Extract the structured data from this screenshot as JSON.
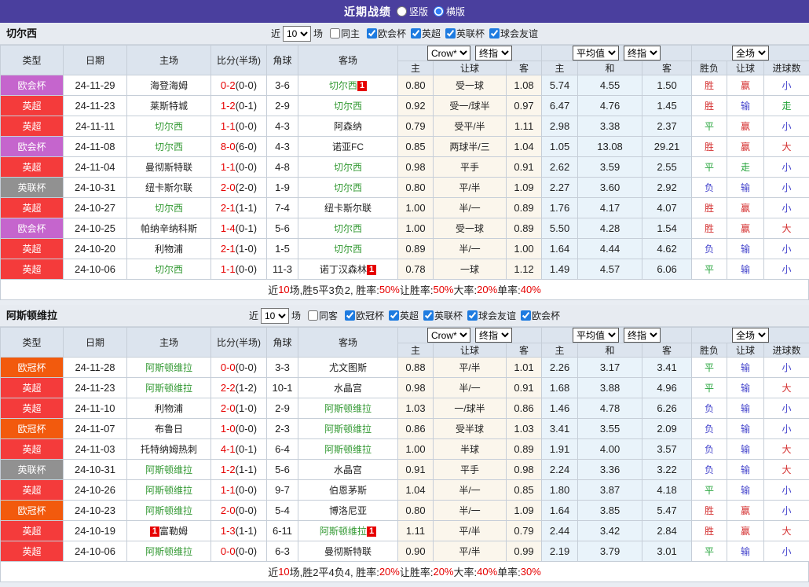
{
  "topbar": {
    "title": "近期战绩",
    "radios": [
      {
        "label": "竖版",
        "checked": false
      },
      {
        "label": "横版",
        "checked": true
      }
    ]
  },
  "columns": [
    "类型",
    "日期",
    "主场",
    "比分(半场)",
    "角球",
    "客场",
    "主",
    "让球",
    "客",
    "主",
    "和",
    "客",
    "胜负",
    "让球",
    "进球数"
  ],
  "dropdowns": {
    "book": "Crow*",
    "final_a": "终指",
    "avg": "平均值",
    "final_b": "终指",
    "scope": "全场"
  },
  "comp_colors": {
    "欧会杯": "#c565cd",
    "英超": "#f43b3b",
    "英联杯": "#919191",
    "欧冠杯": "#f25a0d"
  },
  "result_colors": {
    "r": "res-r",
    "g": "res-g",
    "b": "res-b"
  },
  "sections": [
    {
      "team": "切尔西",
      "filter": {
        "near": "近",
        "count": "10",
        "games": "场",
        "same": "同主",
        "comps": [
          "欧会杯",
          "英超",
          "英联杯",
          "球会友谊"
        ]
      },
      "rows": [
        {
          "comp": "欧会杯",
          "date": "24-11-29",
          "home": {
            "name": "海登海姆"
          },
          "score": "0-2",
          "half": "(0-0)",
          "corner": "3-6",
          "away": {
            "name": "切尔西",
            "focus": true,
            "rank": "1"
          },
          "odds": [
            "0.80",
            "受一球",
            "1.08"
          ],
          "avg": [
            "5.74",
            "4.55",
            "1.50"
          ],
          "res": [
            [
              "胜",
              "r"
            ],
            [
              "赢",
              "r"
            ],
            [
              "小",
              "b"
            ]
          ]
        },
        {
          "comp": "英超",
          "date": "24-11-23",
          "home": {
            "name": "莱斯特城"
          },
          "score": "1-2",
          "half": "(0-1)",
          "corner": "2-9",
          "away": {
            "name": "切尔西",
            "focus": true
          },
          "odds": [
            "0.92",
            "受一/球半",
            "0.97"
          ],
          "avg": [
            "6.47",
            "4.76",
            "1.45"
          ],
          "res": [
            [
              "胜",
              "r"
            ],
            [
              "输",
              "b"
            ],
            [
              "走",
              "g"
            ]
          ]
        },
        {
          "comp": "英超",
          "date": "24-11-11",
          "home": {
            "name": "切尔西",
            "focus": true
          },
          "score": "1-1",
          "half": "(0-0)",
          "corner": "4-3",
          "away": {
            "name": "阿森纳"
          },
          "odds": [
            "0.79",
            "受平/半",
            "1.11"
          ],
          "avg": [
            "2.98",
            "3.38",
            "2.37"
          ],
          "res": [
            [
              "平",
              "g"
            ],
            [
              "赢",
              "r"
            ],
            [
              "小",
              "b"
            ]
          ]
        },
        {
          "comp": "欧会杯",
          "date": "24-11-08",
          "home": {
            "name": "切尔西",
            "focus": true
          },
          "score": "8-0",
          "half": "(6-0)",
          "corner": "4-3",
          "away": {
            "name": "诺亚FC"
          },
          "odds": [
            "0.85",
            "两球半/三",
            "1.04"
          ],
          "avg": [
            "1.05",
            "13.08",
            "29.21"
          ],
          "res": [
            [
              "胜",
              "r"
            ],
            [
              "赢",
              "r"
            ],
            [
              "大",
              "r"
            ]
          ]
        },
        {
          "comp": "英超",
          "date": "24-11-04",
          "home": {
            "name": "曼彻斯特联"
          },
          "score": "1-1",
          "half": "(0-0)",
          "corner": "4-8",
          "away": {
            "name": "切尔西",
            "focus": true
          },
          "odds": [
            "0.98",
            "平手",
            "0.91"
          ],
          "avg": [
            "2.62",
            "3.59",
            "2.55"
          ],
          "res": [
            [
              "平",
              "g"
            ],
            [
              "走",
              "g"
            ],
            [
              "小",
              "b"
            ]
          ]
        },
        {
          "comp": "英联杯",
          "date": "24-10-31",
          "home": {
            "name": "纽卡斯尔联"
          },
          "score": "2-0",
          "half": "(2-0)",
          "corner": "1-9",
          "away": {
            "name": "切尔西",
            "focus": true
          },
          "odds": [
            "0.80",
            "平/半",
            "1.09"
          ],
          "avg": [
            "2.27",
            "3.60",
            "2.92"
          ],
          "res": [
            [
              "负",
              "b"
            ],
            [
              "输",
              "b"
            ],
            [
              "小",
              "b"
            ]
          ]
        },
        {
          "comp": "英超",
          "date": "24-10-27",
          "home": {
            "name": "切尔西",
            "focus": true
          },
          "score": "2-1",
          "half": "(1-1)",
          "corner": "7-4",
          "away": {
            "name": "纽卡斯尔联"
          },
          "odds": [
            "1.00",
            "半/一",
            "0.89"
          ],
          "avg": [
            "1.76",
            "4.17",
            "4.07"
          ],
          "res": [
            [
              "胜",
              "r"
            ],
            [
              "赢",
              "r"
            ],
            [
              "小",
              "b"
            ]
          ]
        },
        {
          "comp": "欧会杯",
          "date": "24-10-25",
          "home": {
            "name": "帕纳辛纳科斯"
          },
          "score": "1-4",
          "half": "(0-1)",
          "corner": "5-6",
          "away": {
            "name": "切尔西",
            "focus": true
          },
          "odds": [
            "1.00",
            "受一球",
            "0.89"
          ],
          "avg": [
            "5.50",
            "4.28",
            "1.54"
          ],
          "res": [
            [
              "胜",
              "r"
            ],
            [
              "赢",
              "r"
            ],
            [
              "大",
              "r"
            ]
          ]
        },
        {
          "comp": "英超",
          "date": "24-10-20",
          "home": {
            "name": "利物浦"
          },
          "score": "2-1",
          "half": "(1-0)",
          "corner": "1-5",
          "away": {
            "name": "切尔西",
            "focus": true
          },
          "odds": [
            "0.89",
            "半/一",
            "1.00"
          ],
          "avg": [
            "1.64",
            "4.44",
            "4.62"
          ],
          "res": [
            [
              "负",
              "b"
            ],
            [
              "输",
              "b"
            ],
            [
              "小",
              "b"
            ]
          ]
        },
        {
          "comp": "英超",
          "date": "24-10-06",
          "home": {
            "name": "切尔西",
            "focus": true
          },
          "score": "1-1",
          "half": "(0-0)",
          "corner": "11-3",
          "away": {
            "name": "诺丁汉森林",
            "rank": "1"
          },
          "odds": [
            "0.78",
            "一球",
            "1.12"
          ],
          "avg": [
            "1.49",
            "4.57",
            "6.06"
          ],
          "res": [
            [
              "平",
              "g"
            ],
            [
              "输",
              "b"
            ],
            [
              "小",
              "b"
            ]
          ]
        }
      ],
      "summary": [
        [
          "近",
          "k"
        ],
        [
          "10",
          "r"
        ],
        [
          "场,胜5平3负2, 胜率:",
          "k"
        ],
        [
          "50%",
          "r"
        ],
        [
          " 让胜率:",
          "k"
        ],
        [
          "50%",
          "r"
        ],
        [
          " 大率:",
          "k"
        ],
        [
          "20%",
          "r"
        ],
        [
          " 单率:",
          "k"
        ],
        [
          "40%",
          "r"
        ]
      ]
    },
    {
      "team": "阿斯顿维拉",
      "filter": {
        "near": "近",
        "count": "10",
        "games": "场",
        "same": "同客",
        "comps": [
          "欧冠杯",
          "英超",
          "英联杯",
          "球会友谊",
          "欧会杯"
        ]
      },
      "rows": [
        {
          "comp": "欧冠杯",
          "date": "24-11-28",
          "home": {
            "name": "阿斯顿维拉",
            "focus": true
          },
          "score": "0-0",
          "half": "(0-0)",
          "corner": "3-3",
          "away": {
            "name": "尤文图斯"
          },
          "odds": [
            "0.88",
            "平/半",
            "1.01"
          ],
          "avg": [
            "2.26",
            "3.17",
            "3.41"
          ],
          "res": [
            [
              "平",
              "g"
            ],
            [
              "输",
              "b"
            ],
            [
              "小",
              "b"
            ]
          ]
        },
        {
          "comp": "英超",
          "date": "24-11-23",
          "home": {
            "name": "阿斯顿维拉",
            "focus": true
          },
          "score": "2-2",
          "half": "(1-2)",
          "corner": "10-1",
          "away": {
            "name": "水晶宫"
          },
          "odds": [
            "0.98",
            "半/一",
            "0.91"
          ],
          "avg": [
            "1.68",
            "3.88",
            "4.96"
          ],
          "res": [
            [
              "平",
              "g"
            ],
            [
              "输",
              "b"
            ],
            [
              "大",
              "r"
            ]
          ]
        },
        {
          "comp": "英超",
          "date": "24-11-10",
          "home": {
            "name": "利物浦"
          },
          "score": "2-0",
          "half": "(1-0)",
          "corner": "2-9",
          "away": {
            "name": "阿斯顿维拉",
            "focus": true
          },
          "odds": [
            "1.03",
            "一/球半",
            "0.86"
          ],
          "avg": [
            "1.46",
            "4.78",
            "6.26"
          ],
          "res": [
            [
              "负",
              "b"
            ],
            [
              "输",
              "b"
            ],
            [
              "小",
              "b"
            ]
          ]
        },
        {
          "comp": "欧冠杯",
          "date": "24-11-07",
          "home": {
            "name": "布鲁日"
          },
          "score": "1-0",
          "half": "(0-0)",
          "corner": "2-3",
          "away": {
            "name": "阿斯顿维拉",
            "focus": true
          },
          "odds": [
            "0.86",
            "受半球",
            "1.03"
          ],
          "avg": [
            "3.41",
            "3.55",
            "2.09"
          ],
          "res": [
            [
              "负",
              "b"
            ],
            [
              "输",
              "b"
            ],
            [
              "小",
              "b"
            ]
          ]
        },
        {
          "comp": "英超",
          "date": "24-11-03",
          "home": {
            "name": "托特纳姆热刺"
          },
          "score": "4-1",
          "half": "(0-1)",
          "corner": "6-4",
          "away": {
            "name": "阿斯顿维拉",
            "focus": true
          },
          "odds": [
            "1.00",
            "半球",
            "0.89"
          ],
          "avg": [
            "1.91",
            "4.00",
            "3.57"
          ],
          "res": [
            [
              "负",
              "b"
            ],
            [
              "输",
              "b"
            ],
            [
              "大",
              "r"
            ]
          ]
        },
        {
          "comp": "英联杯",
          "date": "24-10-31",
          "home": {
            "name": "阿斯顿维拉",
            "focus": true
          },
          "score": "1-2",
          "half": "(1-1)",
          "corner": "5-6",
          "away": {
            "name": "水晶宫"
          },
          "odds": [
            "0.91",
            "平手",
            "0.98"
          ],
          "avg": [
            "2.24",
            "3.36",
            "3.22"
          ],
          "res": [
            [
              "负",
              "b"
            ],
            [
              "输",
              "b"
            ],
            [
              "大",
              "r"
            ]
          ]
        },
        {
          "comp": "英超",
          "date": "24-10-26",
          "home": {
            "name": "阿斯顿维拉",
            "focus": true
          },
          "score": "1-1",
          "half": "(0-0)",
          "corner": "9-7",
          "away": {
            "name": "伯恩茅斯"
          },
          "odds": [
            "1.04",
            "半/一",
            "0.85"
          ],
          "avg": [
            "1.80",
            "3.87",
            "4.18"
          ],
          "res": [
            [
              "平",
              "g"
            ],
            [
              "输",
              "b"
            ],
            [
              "小",
              "b"
            ]
          ]
        },
        {
          "comp": "欧冠杯",
          "date": "24-10-23",
          "home": {
            "name": "阿斯顿维拉",
            "focus": true
          },
          "score": "2-0",
          "half": "(0-0)",
          "corner": "5-4",
          "away": {
            "name": "博洛尼亚"
          },
          "odds": [
            "0.80",
            "半/一",
            "1.09"
          ],
          "avg": [
            "1.64",
            "3.85",
            "5.47"
          ],
          "res": [
            [
              "胜",
              "r"
            ],
            [
              "赢",
              "r"
            ],
            [
              "小",
              "b"
            ]
          ]
        },
        {
          "comp": "英超",
          "date": "24-10-19",
          "home": {
            "name": "富勒姆",
            "rank": "1",
            "rank_before": true
          },
          "score": "1-3",
          "half": "(1-1)",
          "corner": "6-11",
          "away": {
            "name": "阿斯顿维拉",
            "focus": true,
            "rank": "1"
          },
          "odds": [
            "1.11",
            "平/半",
            "0.79"
          ],
          "avg": [
            "2.44",
            "3.42",
            "2.84"
          ],
          "res": [
            [
              "胜",
              "r"
            ],
            [
              "赢",
              "r"
            ],
            [
              "大",
              "r"
            ]
          ]
        },
        {
          "comp": "英超",
          "date": "24-10-06",
          "home": {
            "name": "阿斯顿维拉",
            "focus": true
          },
          "score": "0-0",
          "half": "(0-0)",
          "corner": "6-3",
          "away": {
            "name": "曼彻斯特联"
          },
          "odds": [
            "0.90",
            "平/半",
            "0.99"
          ],
          "avg": [
            "2.19",
            "3.79",
            "3.01"
          ],
          "res": [
            [
              "平",
              "g"
            ],
            [
              "输",
              "b"
            ],
            [
              "小",
              "b"
            ]
          ]
        }
      ],
      "summary": [
        [
          "近",
          "k"
        ],
        [
          "10",
          "r"
        ],
        [
          "场,胜2平4负4, 胜率:",
          "k"
        ],
        [
          "20%",
          "r"
        ],
        [
          " 让胜率:",
          "k"
        ],
        [
          "20%",
          "r"
        ],
        [
          " 大率:",
          "k"
        ],
        [
          "40%",
          "r"
        ],
        [
          " 单率:",
          "k"
        ],
        [
          "30%",
          "r"
        ]
      ]
    }
  ]
}
